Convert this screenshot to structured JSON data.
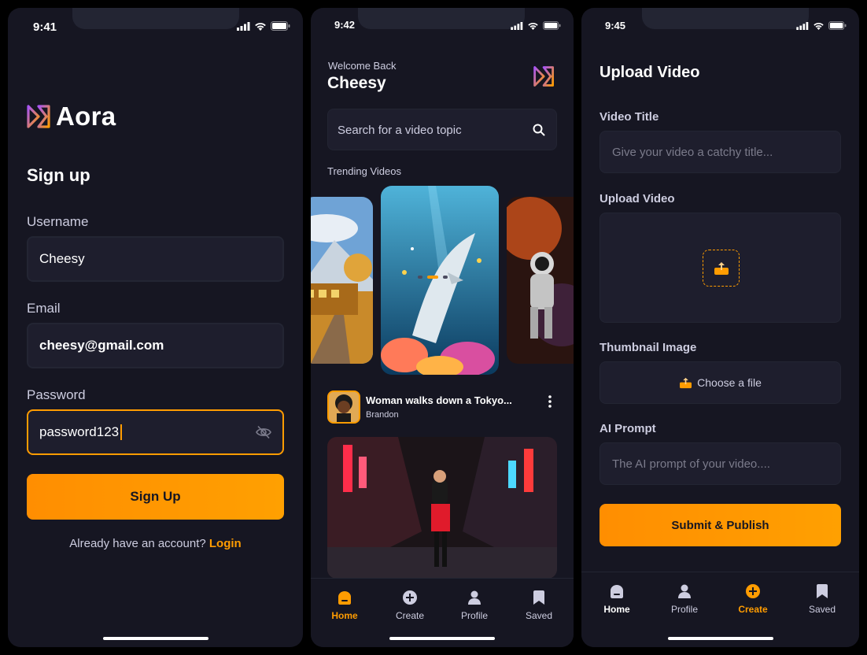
{
  "colors": {
    "background": "#161622",
    "field": "#1e1e2d",
    "accent": "#ff9c01",
    "text_muted": "#cdcde0"
  },
  "signup": {
    "status_time": "9:41",
    "app_name": "Aora",
    "title": "Sign up",
    "username_label": "Username",
    "username_value": "Cheesy",
    "email_label": "Email",
    "email_value": "cheesy@gmail.com",
    "password_label": "Password",
    "password_value": "password123",
    "submit_label": "Sign Up",
    "login_prompt": "Already have an account?",
    "login_link": "Login",
    "icons": {
      "logo": "aora-logo-icon",
      "password_toggle": "eye-slash-icon"
    }
  },
  "home": {
    "status_time": "9:42",
    "welcome": "Welcome Back",
    "user_name": "Cheesy",
    "search_placeholder": "Search for a video topic",
    "trending_title": "Trending Videos",
    "trending_active_index": 1,
    "video": {
      "title": "Woman walks down a Tokyo...",
      "creator": "Brandon"
    },
    "tabs": [
      {
        "label": "Home",
        "icon": "home-icon",
        "active": true
      },
      {
        "label": "Create",
        "icon": "plus-circle-icon",
        "active": false
      },
      {
        "label": "Profile",
        "icon": "profile-icon",
        "active": false
      },
      {
        "label": "Saved",
        "icon": "bookmark-icon",
        "active": false
      }
    ]
  },
  "upload": {
    "status_time": "9:45",
    "title": "Upload Video",
    "video_title_label": "Video Title",
    "video_title_placeholder": "Give your video a catchy title...",
    "upload_video_label": "Upload Video",
    "thumbnail_label": "Thumbnail Image",
    "choose_file": "Choose a file",
    "prompt_label": "AI Prompt",
    "prompt_placeholder": "The AI prompt of your video....",
    "submit_label": "Submit & Publish",
    "tabs": [
      {
        "label": "Home",
        "icon": "home-icon",
        "active": false
      },
      {
        "label": "Profile",
        "icon": "profile-icon",
        "active": false
      },
      {
        "label": "Create",
        "icon": "plus-circle-icon",
        "active": true
      },
      {
        "label": "Saved",
        "icon": "bookmark-icon",
        "active": false
      }
    ]
  }
}
